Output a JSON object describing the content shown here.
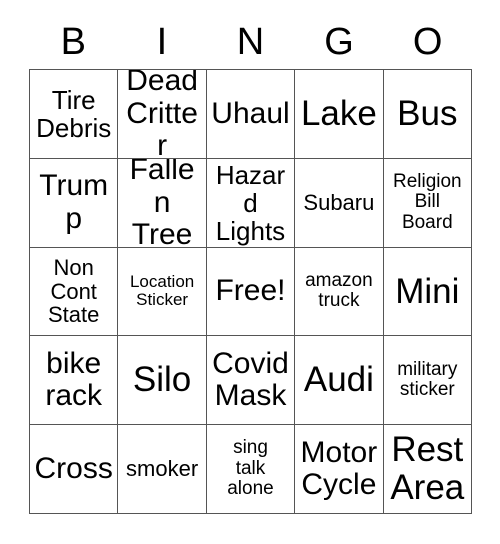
{
  "card": {
    "title": "BINGO",
    "header_letters": [
      "B",
      "I",
      "N",
      "G",
      "O"
    ],
    "columns": 5,
    "rows": 5,
    "free_space": "Free!",
    "border_color": "#555555",
    "text_color": "#000000",
    "background_color": "#ffffff",
    "cells": [
      {
        "text": "Tire\nDebris",
        "size": "md",
        "row": 1,
        "col": 1
      },
      {
        "text": "Dead\nCritter",
        "size": "lg",
        "row": 1,
        "col": 2
      },
      {
        "text": "Uhaul",
        "size": "lg",
        "row": 1,
        "col": 3
      },
      {
        "text": "Lake",
        "size": "xl",
        "row": 1,
        "col": 4
      },
      {
        "text": "Bus",
        "size": "xl",
        "row": 1,
        "col": 5
      },
      {
        "text": "Trump",
        "size": "lg",
        "row": 2,
        "col": 1
      },
      {
        "text": "Fallen\nTree",
        "size": "lg",
        "row": 2,
        "col": 2
      },
      {
        "text": "Hazard\nLights",
        "size": "md",
        "row": 2,
        "col": 3
      },
      {
        "text": "Subaru",
        "size": "sm",
        "row": 2,
        "col": 4
      },
      {
        "text": "Religion\nBill\nBoard",
        "size": "xs",
        "row": 2,
        "col": 5
      },
      {
        "text": "Non\nCont\nState",
        "size": "sm",
        "row": 3,
        "col": 1
      },
      {
        "text": "Location\nSticker",
        "size": "xxs",
        "row": 3,
        "col": 2
      },
      {
        "text": "Free!",
        "size": "lg",
        "row": 3,
        "col": 3
      },
      {
        "text": "amazon\ntruck",
        "size": "xs",
        "row": 3,
        "col": 4
      },
      {
        "text": "Mini",
        "size": "xl",
        "row": 3,
        "col": 5
      },
      {
        "text": "bike\nrack",
        "size": "lg",
        "row": 4,
        "col": 1
      },
      {
        "text": "Silo",
        "size": "xl",
        "row": 4,
        "col": 2
      },
      {
        "text": "Covid\nMask",
        "size": "lg",
        "row": 4,
        "col": 3
      },
      {
        "text": "Audi",
        "size": "xl",
        "row": 4,
        "col": 4
      },
      {
        "text": "military\nsticker",
        "size": "xs",
        "row": 4,
        "col": 5
      },
      {
        "text": "Cross",
        "size": "lg",
        "row": 5,
        "col": 1
      },
      {
        "text": "smoker",
        "size": "sm",
        "row": 5,
        "col": 2
      },
      {
        "text": "sing\ntalk\nalone",
        "size": "xs",
        "row": 5,
        "col": 3
      },
      {
        "text": "Motor\nCycle",
        "size": "lg",
        "row": 5,
        "col": 4
      },
      {
        "text": "Rest\nArea",
        "size": "xl",
        "row": 5,
        "col": 5
      }
    ]
  }
}
